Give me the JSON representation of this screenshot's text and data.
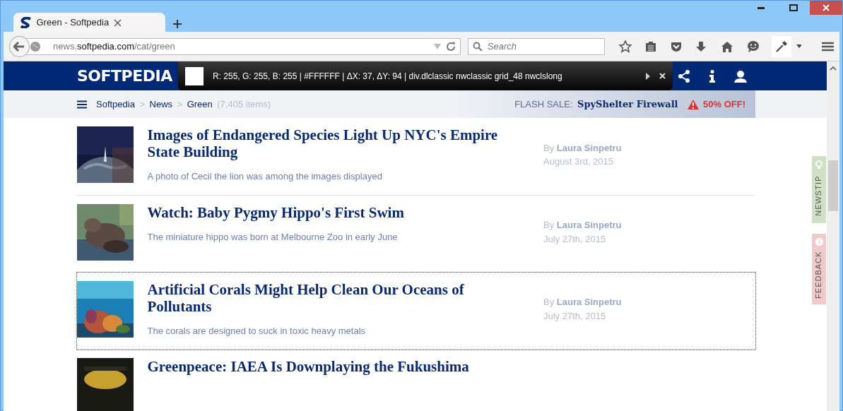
{
  "tabs": [
    {
      "title": "Green - Softpedia",
      "selected": true
    }
  ],
  "address": {
    "prefix": "news.",
    "domain": "softpedia.com",
    "path": "/cat/green"
  },
  "search": {
    "placeholder": "Search"
  },
  "site": {
    "logo": "SOFTPEDIA",
    "breadcrumbs": [
      {
        "label": "Softpedia",
        "sep": ">"
      },
      {
        "label": "News",
        "sep": ">"
      },
      {
        "label": "Green"
      }
    ],
    "count": "(7,405 items)",
    "flash_sale": {
      "label": "FLASH SALE:",
      "product": "SpyShelter Firewall",
      "discount": "50% OFF!"
    }
  },
  "inspector": {
    "text": "R: 255, G: 255, B: 255 | #FFFFFF | ΔX: 37, ΔY: 94 | div.dlclassic nwclassic grid_48 nwclslong"
  },
  "articles": [
    {
      "title": "Images of Endangered Species Light Up NYC's Empire State Building",
      "summary": "A photo of Cecil the lion was among the images displayed",
      "by": "By",
      "author": "Laura Sinpetru",
      "date": "August 3rd, 2015",
      "inspected": false,
      "kind": "space"
    },
    {
      "title": "Watch: Baby Pygmy Hippo's First Swim",
      "summary": "The miniature hippo was born at Melbourne Zoo in early June",
      "by": "By",
      "author": "Laura Sinpetru",
      "date": "July 27th, 2015",
      "inspected": false,
      "kind": "animal"
    },
    {
      "title": "Artificial Corals Might Help Clean Our Oceans of Pollutants",
      "summary": "The corals are designed to suck in toxic heavy metals",
      "by": "By",
      "author": "Laura Sinpetru",
      "date": "July 27th, 2015",
      "inspected": true,
      "kind": "reef"
    },
    {
      "title": "Greenpeace: IAEA Is Downplaying the Fukushima",
      "inspected": false,
      "kind": "dark"
    }
  ],
  "side_tabs": [
    {
      "label": "NEWSTIP",
      "kind": "tip",
      "color": "#cfe0c4"
    },
    {
      "label": "FEEDBACK",
      "kind": "info",
      "color": "#f2c9cb"
    }
  ]
}
